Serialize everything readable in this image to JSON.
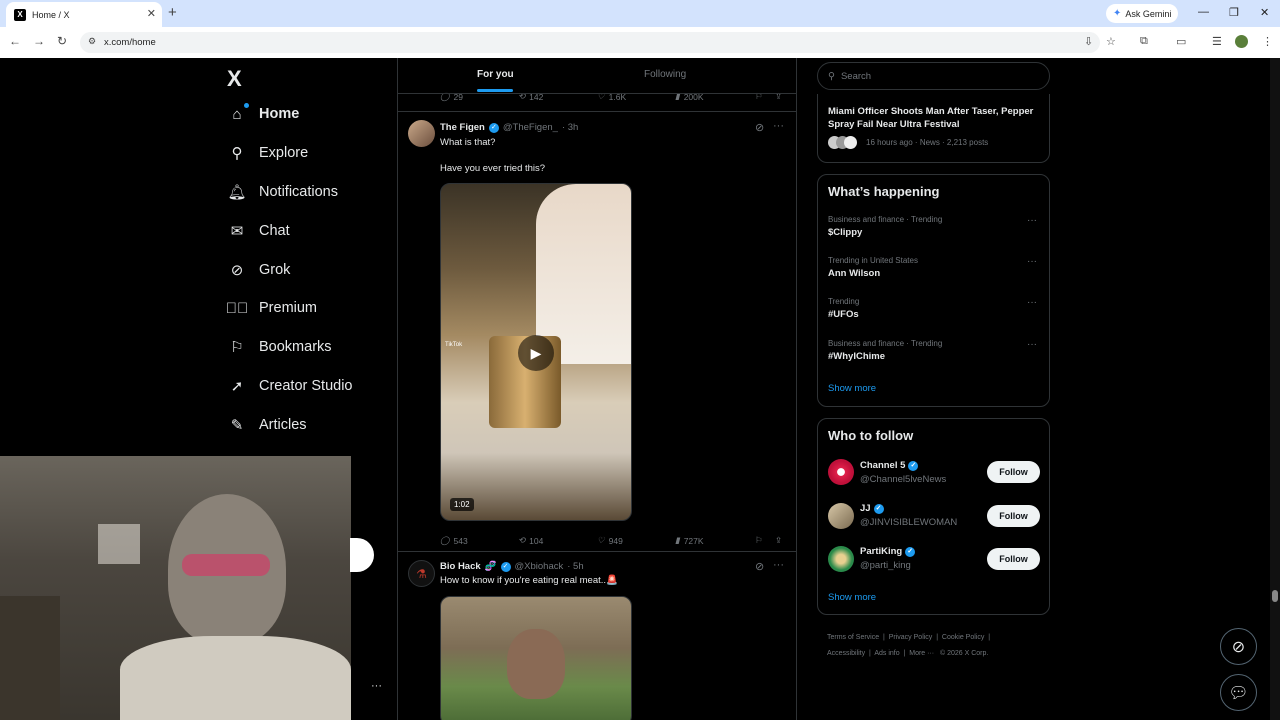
{
  "browser": {
    "tab_title": "Home / X",
    "tab_icon": "X",
    "url": "x.com/home",
    "gemini_label": "Ask Gemini"
  },
  "nav": {
    "logo": "X",
    "items": [
      {
        "label": "Home",
        "icon": "home-icon"
      },
      {
        "label": "Explore",
        "icon": "search-icon"
      },
      {
        "label": "Notifications",
        "icon": "bell-icon"
      },
      {
        "label": "Chat",
        "icon": "mail-icon"
      },
      {
        "label": "Grok",
        "icon": "grok-icon"
      },
      {
        "label": "Premium",
        "icon": "premium-icon"
      },
      {
        "label": "Bookmarks",
        "icon": "bookmark-icon"
      },
      {
        "label": "Creator Studio",
        "icon": "rocket-icon"
      },
      {
        "label": "Articles",
        "icon": "article-icon"
      }
    ]
  },
  "feed": {
    "tabs": [
      "For you",
      "Following"
    ],
    "prev_post_actions": {
      "replies": "29",
      "reposts": "142",
      "likes": "1.6K",
      "views": "200K"
    },
    "posts": [
      {
        "name": "The Figen",
        "handle": "@TheFigen_",
        "time": "· 3h",
        "line1": "What is that?",
        "line2": "Have you ever tried this?",
        "video_duration": "1:02",
        "watermark": "TikTok",
        "actions": {
          "replies": "543",
          "reposts": "104",
          "likes": "949",
          "views": "727K"
        }
      },
      {
        "name": "Bio Hack",
        "name_emoji": "🧬",
        "handle": "@Xbiohack",
        "time": "· 5h",
        "line1": "How to know if you're eating real meat..🚨"
      }
    ]
  },
  "right": {
    "search_placeholder": "Search",
    "news": {
      "title": "Miami Officer Shoots Man After Taser, Pepper Spray Fail Near Ultra Festival",
      "meta": "16 hours ago · News · 2,213 posts"
    },
    "happening": {
      "title": "What’s happening",
      "trends": [
        {
          "context": "Business and finance · Trending",
          "name": "$Clippy"
        },
        {
          "context": "Trending in United States",
          "name": "Ann Wilson"
        },
        {
          "context": "Trending",
          "name": "#UFOs"
        },
        {
          "context": "Business and finance · Trending",
          "name": "#WhyIChime"
        }
      ],
      "show_more": "Show more"
    },
    "who_to_follow": {
      "title": "Who to follow",
      "accounts": [
        {
          "name": "Channel 5",
          "handle": "@Channel5lveNews",
          "button": "Follow"
        },
        {
          "name": "JJ",
          "handle": "@JINVISIBLEWOMAN",
          "button": "Follow"
        },
        {
          "name": "PartiKing",
          "handle": "@parti_king",
          "button": "Follow"
        }
      ],
      "show_more": "Show more"
    },
    "footer": {
      "links": [
        "Terms of Service",
        "Privacy Policy",
        "Cookie Policy",
        "Accessibility",
        "Ads info",
        "More ···"
      ],
      "copyright": "© 2026 X Corp."
    }
  }
}
